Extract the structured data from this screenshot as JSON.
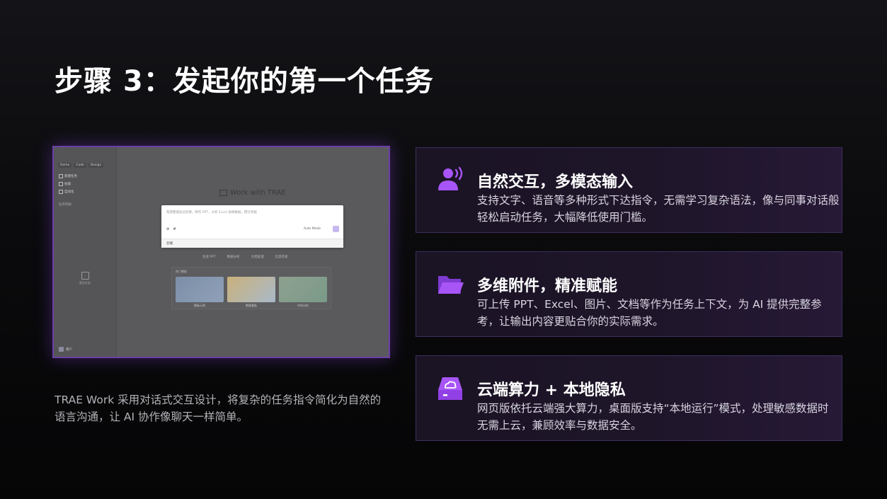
{
  "slide": {
    "title": "步骤 3：发起你的第一个任务",
    "caption": "TRAE Work 采用对话式交互设计，将复杂的任务指令简化为自然的语言沟通，让 AI 协作像聊天一样简单。"
  },
  "screenshot": {
    "tabs": [
      "Home",
      "Code",
      "Design"
    ],
    "sidebar_items": [
      "新建任务",
      "技能",
      "自动化"
    ],
    "sidebar_section": "任务列表",
    "empty_label": "暂无任务",
    "user_name": "用户",
    "heading": "Work with TRAE",
    "input_placeholder": "帮我整理会议纪要，制作 PPT，分析 Excel 表格数据，撰写周报",
    "mode_label": "Auto Mode",
    "footer_label": "云端",
    "chips": [
      "生成 PPT",
      "数据分析",
      "文档处理",
      "信息检索"
    ],
    "panel_title": "热门模板",
    "cards": [
      {
        "label": "模板示例"
      },
      {
        "label": "数据看板"
      },
      {
        "label": "市场分析"
      }
    ]
  },
  "features": [
    {
      "icon": "voice-user-icon",
      "title": "自然交互，多模态输入",
      "desc": "支持文字、语音等多种形式下达指令，无需学习复杂语法，像与同事对话般轻松启动任务，大幅降低使用门槛。"
    },
    {
      "icon": "folder-icon",
      "title": "多维附件，精准赋能",
      "desc": "可上传 PPT、Excel、图片、文档等作为任务上下文，为 AI 提供完整参考，让输出内容更贴合你的实际需求。"
    },
    {
      "icon": "cloud-drive-icon",
      "title": "云端算力 + 本地隐私",
      "desc": "网页版依托云端强大算力，桌面版支持“本地运行”模式，处理敏感数据时无需上云，兼顾效率与数据安全。"
    }
  ],
  "colors": {
    "accent": "#a855f7",
    "card_border": "#3e2e5c",
    "frame_border": "#6b3fa8"
  }
}
